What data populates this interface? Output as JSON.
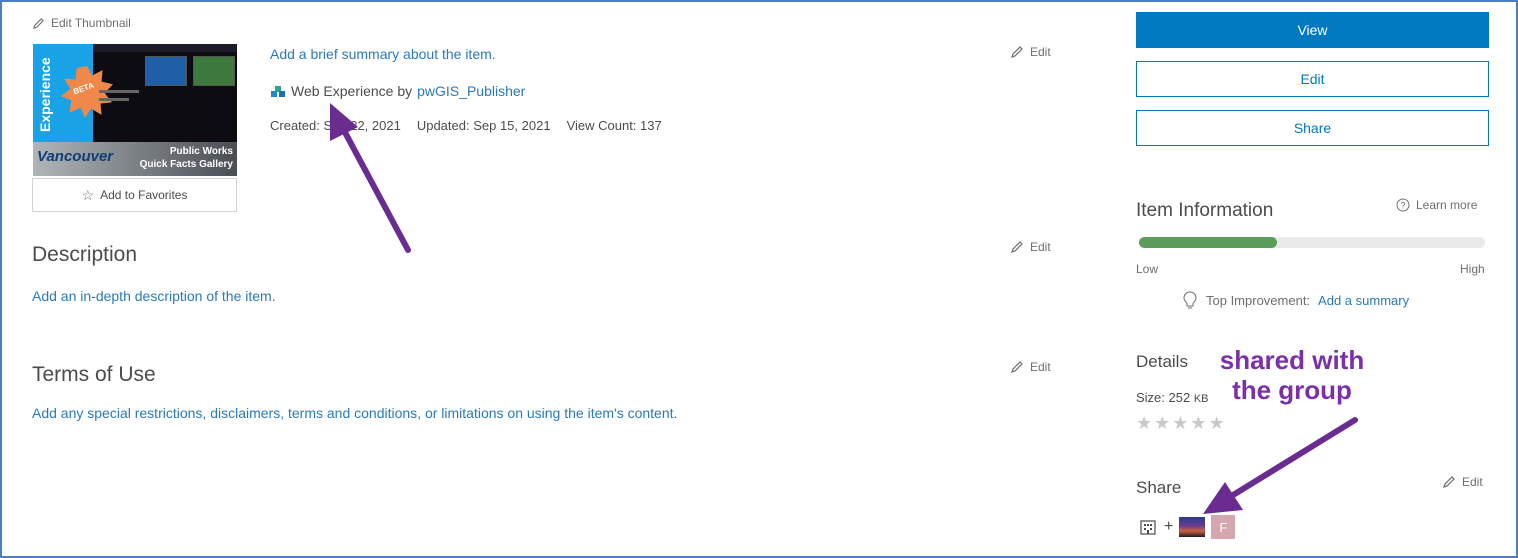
{
  "thumbnail": {
    "edit_label": "Edit Thumbnail",
    "image_big_text": "Experience",
    "image_badge": "BETA",
    "image_city": "Vancouver",
    "image_title_line1": "Public Works",
    "image_title_line2": "Quick Facts Gallery",
    "favorites_label": "Add to Favorites"
  },
  "summary": {
    "text": "Add a brief summary about the item.",
    "edit_label": "Edit",
    "type_label": "Web Experience by",
    "owner": "pwGIS_Publisher",
    "created": "Created: Sep 22, 2021",
    "updated": "Updated: Sep 15, 2021",
    "view_count": "View Count: 137"
  },
  "description": {
    "title": "Description",
    "edit_label": "Edit",
    "text": "Add an in-depth description of the item."
  },
  "terms": {
    "title": "Terms of Use",
    "edit_label": "Edit",
    "text": "Add any special restrictions, disclaimers, terms and conditions, or limitations on using the item's content."
  },
  "actions": {
    "view": "View",
    "edit": "Edit",
    "share": "Share"
  },
  "item_info": {
    "title": "Item Information",
    "learn_more": "Learn more",
    "level_fraction": 0.4,
    "low": "Low",
    "high": "High",
    "improvement_label": "Top Improvement:",
    "improvement_link": "Add a summary"
  },
  "details": {
    "title": "Details",
    "size_label": "Size: 252",
    "size_unit": "KB",
    "rating": 0,
    "rating_max": 5
  },
  "share": {
    "title": "Share",
    "edit_label": "Edit",
    "plus": "+",
    "group_initial": "F"
  },
  "annotation": {
    "line1": "shared with",
    "line2": "the group"
  },
  "colors": {
    "accent": "#0079c1",
    "link": "#2b7ab8",
    "annotation": "#7b2fa8",
    "meter_fill": "#5a9e5a"
  }
}
